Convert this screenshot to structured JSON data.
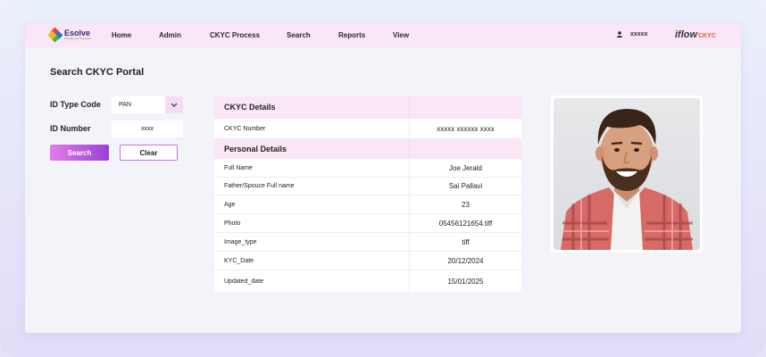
{
  "header": {
    "logo_name": "Esolve",
    "logo_tagline": "Simplify your business",
    "nav": [
      "Home",
      "Admin",
      "CKYC Process",
      "Search",
      "Reports",
      "View"
    ],
    "user_name": "xxxxx",
    "brand_main": "iflow",
    "brand_sub": "CKYC"
  },
  "page": {
    "title": "Search CKYC Portal"
  },
  "form": {
    "id_type_label": "ID Type Code",
    "id_type_value": "PAN",
    "id_number_label": "ID Number",
    "id_number_value": "xxxx",
    "search_label": "Search",
    "clear_label": "Clear"
  },
  "details": {
    "ckyc_header": "CKYC Details",
    "ckyc_number_label": "CKYC Number",
    "ckyc_number_value": "xxxxx xxxxxx xxxx",
    "personal_header": "Personal Details",
    "rows": [
      {
        "label": "Full Name",
        "value": "Joe Jerald"
      },
      {
        "label": "Father/Spouce Full name",
        "value": "Sai Pallavi"
      },
      {
        "label": "Age",
        "value": "23"
      },
      {
        "label": "Photo",
        "value": "05456121654.tiff"
      },
      {
        "label": "Image_type",
        "value": "tiff"
      },
      {
        "label": "KYC_Date",
        "value": "20/12/2024"
      },
      {
        "label": "Updated_date",
        "value": "15/01/2025"
      }
    ]
  },
  "colors": {
    "nav_bg": "#f9e6f6",
    "accent_purple": "#9b3fd6",
    "accent_pink": "#e27de6",
    "brand_orange": "#e85a2c"
  }
}
